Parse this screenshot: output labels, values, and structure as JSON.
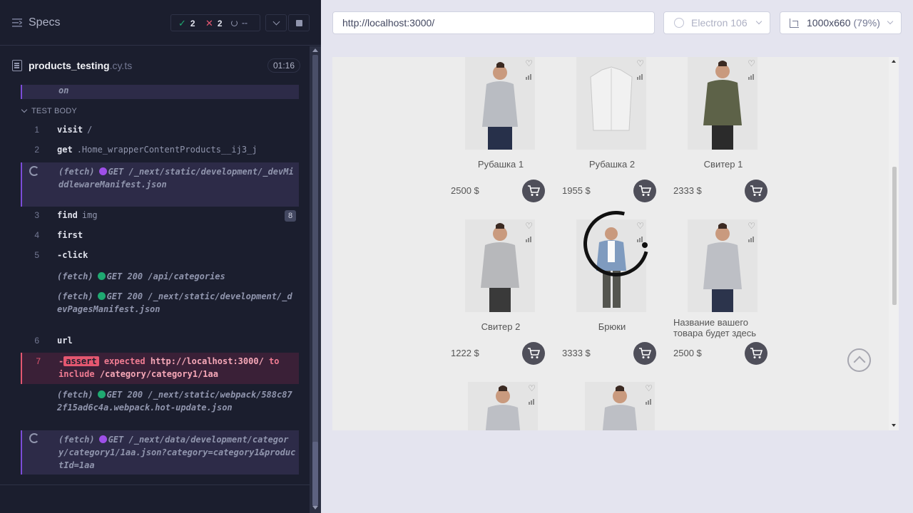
{
  "runner": {
    "header_title": "Specs",
    "stats": {
      "passed": "2",
      "failed": "2",
      "pending": "--"
    },
    "spec": {
      "name": "products_testing",
      "ext": ".cy.ts",
      "duration": "01:16"
    },
    "overflow_text": "on",
    "section_title": "TEST BODY",
    "commands": [
      {
        "num": "1",
        "name": "visit",
        "arg": "/"
      },
      {
        "num": "2",
        "name": "get",
        "arg": ".Home_wrapperContentProducts__ij3_j"
      },
      {
        "num": "3",
        "name": "find",
        "arg": "img",
        "count": "8"
      },
      {
        "num": "4",
        "name": "first",
        "arg": ""
      },
      {
        "num": "5",
        "name": "-click",
        "arg": ""
      },
      {
        "num": "6",
        "name": "url",
        "arg": ""
      },
      {
        "num": "7"
      }
    ],
    "fetch1": {
      "label": "(fetch)",
      "method": "GET",
      "path": "/_next/static/development/_devMiddlewareManifest.json"
    },
    "fetch2": {
      "label": "(fetch)",
      "method": "GET 200",
      "path": "/api/categories"
    },
    "fetch3": {
      "label": "(fetch)",
      "method": "GET 200",
      "path": "/_next/static/development/_devPagesManifest.json"
    },
    "assert": {
      "prefix": "-",
      "tag": "assert",
      "expected": "expected",
      "actual": "http://localhost:3000/",
      "to": "to",
      "include": "include",
      "value": "/category/category1/1aa"
    },
    "fetch4": {
      "label": "(fetch)",
      "method": "GET 200",
      "path": "/_next/static/webpack/588c872f15ad6c4a.webpack.hot-update.json"
    },
    "fetch5": {
      "label": "(fetch)",
      "method": "GET",
      "path": "/_next/data/development/category/category1/1aa.json?category=category1&productId=1aa"
    }
  },
  "aut": {
    "url": "http://localhost:3000/",
    "browser": "Electron 106",
    "viewport": "1000x660",
    "zoom": "(79%)"
  },
  "products": [
    {
      "name": "Рубашка 1",
      "price": "2500 $"
    },
    {
      "name": "Рубашка 2",
      "price": "1955 $"
    },
    {
      "name": "Свитер 1",
      "price": "2333 $"
    },
    {
      "name": "Свитер 2",
      "price": "1222 $"
    },
    {
      "name": "Брюки",
      "price": "3333 $"
    },
    {
      "name": "Название вашего товара будет здесь",
      "price": "2500 $"
    }
  ],
  "colors": {
    "runner_bg": "#1b1e2e",
    "pass": "#1fa971",
    "fail": "#e45770",
    "pending_accent": "#7c4cd8",
    "cart_button": "#4f4f5a"
  },
  "icons": {
    "specs": "specs-list-icon",
    "file": "document-icon",
    "spinner": "loading-spinner-icon",
    "heart": "heart-icon",
    "compare": "bar-chart-icon",
    "cart": "shopping-cart-icon",
    "scroll_top": "chevron-up-circle-icon"
  }
}
